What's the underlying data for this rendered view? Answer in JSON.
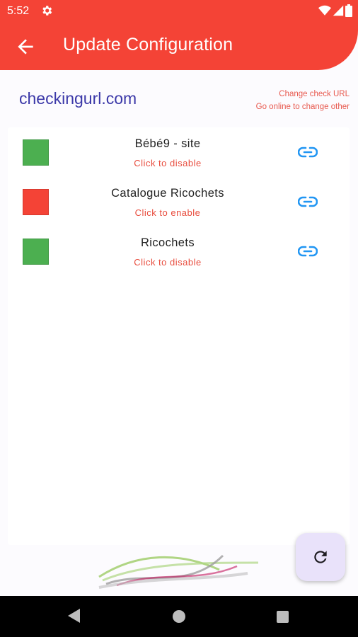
{
  "status_bar": {
    "time": "5:52"
  },
  "app_bar": {
    "title": "Update Configuration",
    "color": "#f44336"
  },
  "check_url": {
    "url": "checkingurl.com",
    "change_label": "Change check URL",
    "online_label": "Go online to change other"
  },
  "sites": [
    {
      "name": "Bébé9 - site",
      "action": "Click to disable",
      "status_color": "#4caf50"
    },
    {
      "name": "Catalogue Ricochets",
      "action": "Click to enable",
      "status_color": "#f44336"
    },
    {
      "name": "Ricochets",
      "action": "Click to disable",
      "status_color": "#4caf50"
    }
  ],
  "icons": {
    "back": "arrow-back-icon",
    "link": "link-icon",
    "refresh": "refresh-icon",
    "settings": "gear-icon"
  }
}
